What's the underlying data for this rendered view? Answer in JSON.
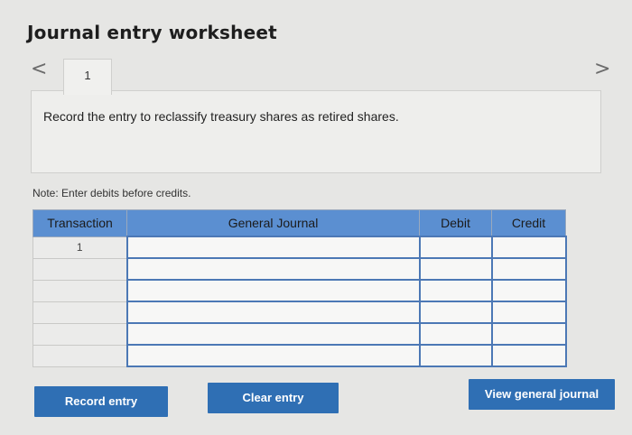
{
  "page": {
    "title": "Journal entry worksheet",
    "nav": {
      "prev_symbol": "<",
      "next_symbol": ">"
    },
    "tabs": [
      {
        "label": "1"
      }
    ],
    "question": "Record the entry to reclassify treasury shares as retired shares.",
    "note": "Note: Enter debits before credits."
  },
  "journal": {
    "headers": {
      "transaction": "Transaction",
      "general_journal": "General Journal",
      "debit": "Debit",
      "credit": "Credit"
    },
    "rows": [
      {
        "transaction": "1",
        "account": "",
        "debit": "",
        "credit": ""
      },
      {
        "transaction": "",
        "account": "",
        "debit": "",
        "credit": ""
      },
      {
        "transaction": "",
        "account": "",
        "debit": "",
        "credit": ""
      },
      {
        "transaction": "",
        "account": "",
        "debit": "",
        "credit": ""
      },
      {
        "transaction": "",
        "account": "",
        "debit": "",
        "credit": ""
      },
      {
        "transaction": "",
        "account": "",
        "debit": "",
        "credit": ""
      }
    ]
  },
  "buttons": {
    "record": "Record entry",
    "clear": "Clear entry",
    "view": "View general journal"
  },
  "colors": {
    "accent": "#2f6fb4",
    "header": "#5b8fd1",
    "background": "#e6e6e4"
  }
}
